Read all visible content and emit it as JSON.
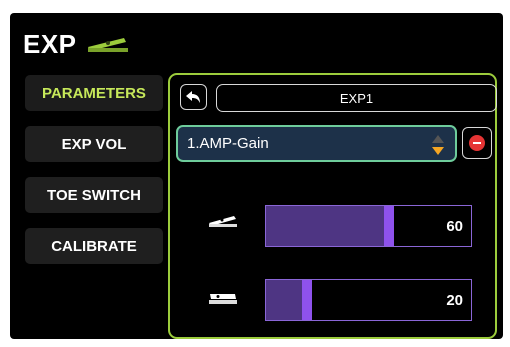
{
  "header": {
    "title": "EXP",
    "icon": "expression-pedal-icon",
    "icon_color": "#9ccc3c"
  },
  "sidebar": {
    "items": [
      {
        "label": "PARAMETERS",
        "active": true
      },
      {
        "label": "EXP VOL",
        "active": false
      },
      {
        "label": "TOE SWITCH",
        "active": false
      },
      {
        "label": "CALIBRATE",
        "active": false
      }
    ]
  },
  "panel": {
    "back_icon": "back-arrow-icon",
    "exp_name": "EXP1",
    "parameter": {
      "selected": "1.AMP-Gain"
    },
    "remove_icon": "remove-icon",
    "toe_down": {
      "icon": "pedal-toe-down-icon",
      "value": "60",
      "level": 0.6
    },
    "heel_down": {
      "icon": "pedal-heel-down-icon",
      "value": "20",
      "level": 0.2
    }
  },
  "colors": {
    "accent": "#9ccc3c",
    "slider_fill": "#4e3583",
    "slider_handle": "#8e52ec",
    "select_bg": "#1d3149",
    "select_border": "#6ecc9b",
    "remove": "#e53434"
  }
}
